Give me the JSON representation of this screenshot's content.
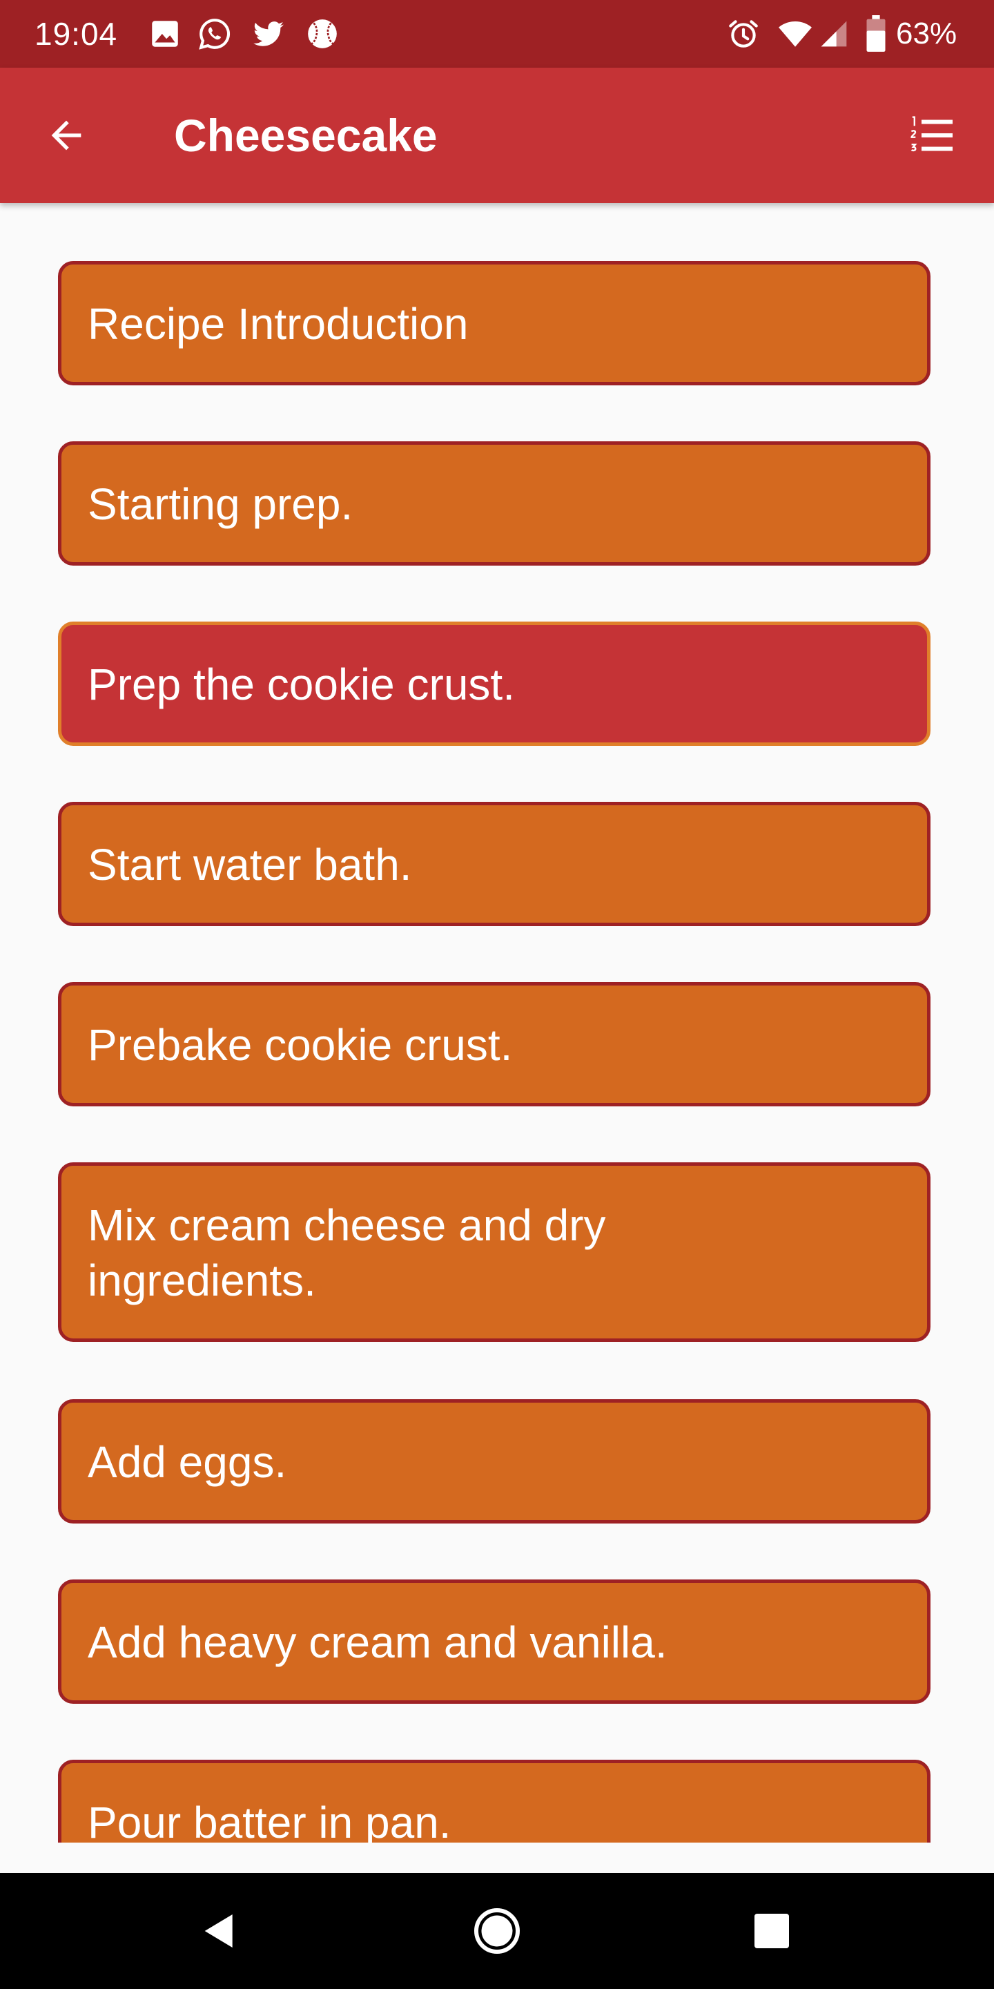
{
  "status_bar": {
    "time": "19:04",
    "battery": "63%",
    "icons": [
      "image-icon",
      "whatsapp-icon",
      "twitter-icon",
      "baseball-icon",
      "alarm-icon",
      "wifi-icon",
      "signal-icon",
      "battery-icon"
    ]
  },
  "app_bar": {
    "title": "Cheesecake",
    "back_icon": "arrow-back-icon",
    "steps_icon": "numbered-list-icon"
  },
  "steps": [
    {
      "label": "Recipe Introduction",
      "active": false
    },
    {
      "label": "Starting prep.",
      "active": false
    },
    {
      "label": "Prep the cookie crust.",
      "active": true
    },
    {
      "label": "Start water bath.",
      "active": false
    },
    {
      "label": "Prebake cookie crust.",
      "active": false
    },
    {
      "label": "Mix cream cheese and dry ingredients.",
      "active": false
    },
    {
      "label": "Add eggs.",
      "active": false
    },
    {
      "label": "Add heavy cream and vanilla.",
      "active": false
    },
    {
      "label": "Pour batter in pan.",
      "active": false
    }
  ],
  "colors": {
    "status_bar": "#9e2124",
    "app_bar": "#c53336",
    "step_background": "#d4691f",
    "step_border": "#9e2124",
    "active_step_background": "#c53336",
    "active_step_border": "#e07f2a",
    "nav_bar": "#000000"
  },
  "nav_bar": {
    "icons": [
      "back-triangle-icon",
      "home-circle-icon",
      "recents-square-icon"
    ]
  }
}
